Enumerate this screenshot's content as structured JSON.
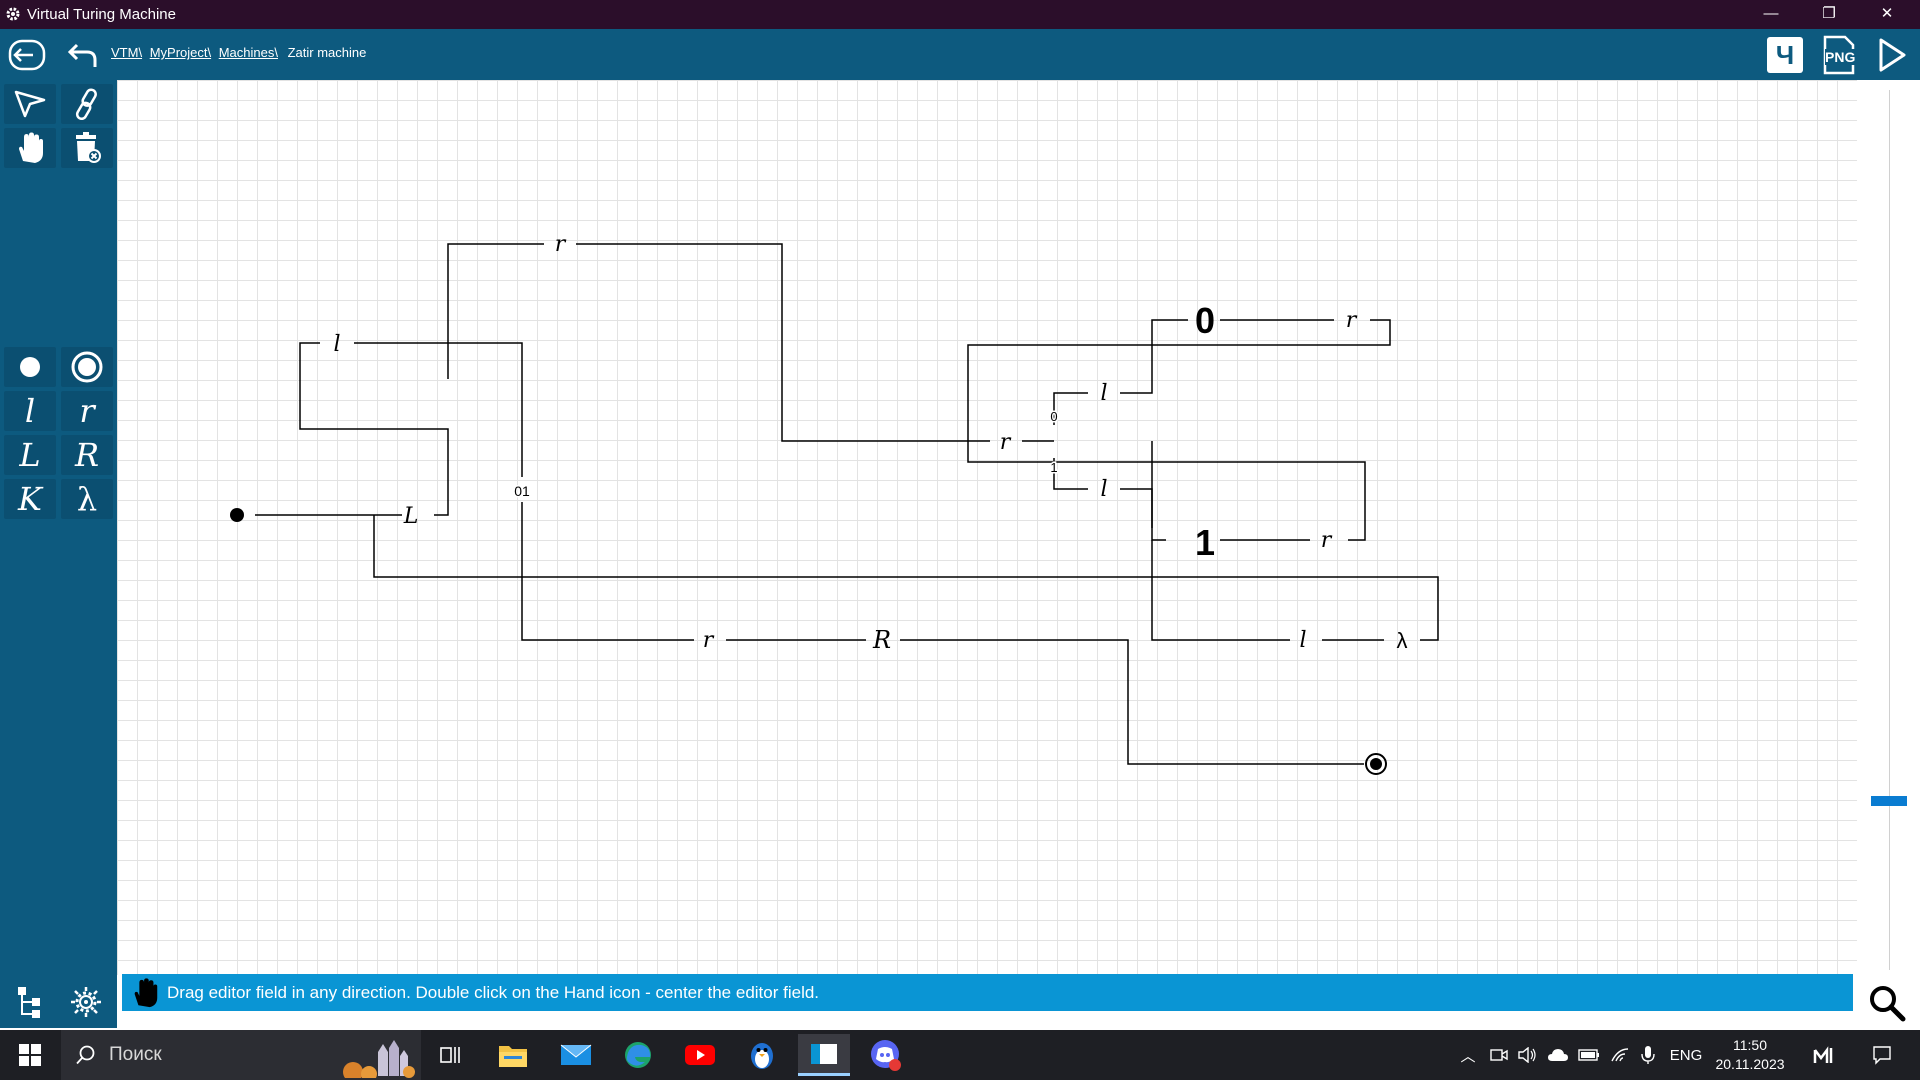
{
  "window": {
    "title": "Virtual Turing Machine",
    "minimize_glyph": "—",
    "restore_glyph": "❐",
    "close_glyph": "✕"
  },
  "toolbar": {
    "breadcrumb": [
      "VTM\\",
      "MyProject\\",
      "Machines\\"
    ],
    "current_machine": "Zatir machine",
    "right_buttons": [
      {
        "name": "language-button",
        "label": "Ч"
      },
      {
        "name": "export-png-button",
        "label": "PNG"
      },
      {
        "name": "run-button",
        "icon": "play-icon"
      }
    ]
  },
  "sidebar": {
    "tools": [
      {
        "name": "select-tool",
        "icon": "arrow-pointer-icon"
      },
      {
        "name": "link-tool",
        "icon": "chain-link-icon"
      },
      {
        "name": "hand-tool",
        "icon": "hand-icon"
      },
      {
        "name": "delete-tool",
        "icon": "trash-icon"
      }
    ],
    "palette": [
      "l",
      "r",
      "L",
      "R",
      "K",
      "λ"
    ],
    "bottom": [
      {
        "name": "tree-view-button",
        "icon": "tree-icon"
      },
      {
        "name": "settings-button",
        "icon": "gear-icon"
      }
    ]
  },
  "diagram": {
    "nodes": [
      {
        "id": "start",
        "label": "●"
      },
      {
        "id": "n_r_top",
        "label": "r"
      },
      {
        "id": "n_l_left",
        "label": "l"
      },
      {
        "id": "n_L",
        "label": "L"
      },
      {
        "id": "n_r_mid",
        "label": "r"
      },
      {
        "id": "n_l_up",
        "label": "l"
      },
      {
        "id": "n_l_down",
        "label": "l"
      },
      {
        "id": "n_zero",
        "label": "0"
      },
      {
        "id": "n_r_zero",
        "label": "r"
      },
      {
        "id": "n_one",
        "label": "1"
      },
      {
        "id": "n_r_one",
        "label": "r"
      },
      {
        "id": "n_r_bottom",
        "label": "r"
      },
      {
        "id": "n_R",
        "label": "R"
      },
      {
        "id": "n_l_bottom",
        "label": "l"
      },
      {
        "id": "n_lambda",
        "label": "λ"
      },
      {
        "id": "end",
        "label": "◉"
      }
    ],
    "edge_labels": [
      "01",
      "0",
      "1"
    ]
  },
  "statusbar": {
    "hint": "Drag editor field in any direction. Double click on the Hand icon - center the editor field."
  },
  "taskbar": {
    "search_placeholder": "Поиск",
    "language": "ENG",
    "time": "11:50",
    "date": "20.11.2023",
    "apps": [
      "task-view",
      "file-explorer",
      "mail",
      "edge",
      "youtube",
      "penguin-app",
      "vtm-app",
      "discord"
    ]
  },
  "colors": {
    "titlebar": "#2b0e2a",
    "toolbar": "#0d5a7f",
    "statusbar": "#0a95d4",
    "taskbar": "#1e1f24",
    "scroll_marker": "#0a7cd1"
  }
}
